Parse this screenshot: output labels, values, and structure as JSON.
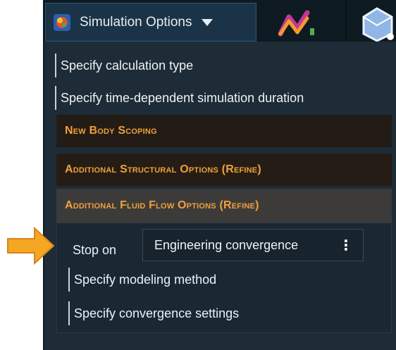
{
  "toolbar": {
    "simulation_options_label": "Simulation Options",
    "icons": [
      "app-logo-icon",
      "chevron-down-icon",
      "results-chart-icon",
      "geometry-mesh-icon"
    ]
  },
  "menu": {
    "items": [
      {
        "label": "Specify calculation type"
      },
      {
        "label": "Specify time-dependent simulation duration"
      }
    ],
    "sections": [
      {
        "title": "New Body Scoping"
      },
      {
        "title": "Additional Structural Options (Refine)"
      },
      {
        "title": "Additional Fluid Flow Options (Refine)"
      }
    ],
    "fluid_flow": {
      "stop_on_label": "Stop on",
      "stop_on_value": "Engineering convergence",
      "kebab": "⋮",
      "items": [
        {
          "label": "Specify modeling method"
        },
        {
          "label": "Specify convergence settings"
        }
      ]
    }
  },
  "colors": {
    "accent_orange": "#f0a03a",
    "panel_bg": "#1d2c36",
    "button_bg": "#1b3346",
    "pointer_arrow": "#f5a623"
  }
}
